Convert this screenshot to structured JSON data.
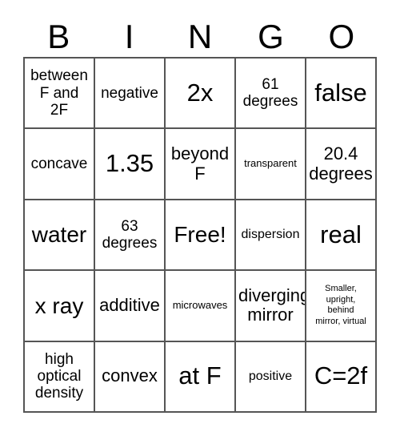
{
  "card": {
    "title": "BINGO",
    "headers": [
      "B",
      "I",
      "N",
      "G",
      "O"
    ],
    "grid": [
      [
        {
          "text": "between\nF and\n2F",
          "size": "md"
        },
        {
          "text": "negative",
          "size": "md"
        },
        {
          "text": "2x",
          "size": "xxl"
        },
        {
          "text": "61\ndegrees",
          "size": "md"
        },
        {
          "text": "false",
          "size": "xxl"
        }
      ],
      [
        {
          "text": "concave",
          "size": "md"
        },
        {
          "text": "1.35",
          "size": "xxl"
        },
        {
          "text": "beyond\nF",
          "size": "lg"
        },
        {
          "text": "transparent",
          "size": "xs"
        },
        {
          "text": "20.4\ndegrees",
          "size": "lg"
        }
      ],
      [
        {
          "text": "water",
          "size": "xl"
        },
        {
          "text": "63\ndegrees",
          "size": "md"
        },
        {
          "text": "Free!",
          "size": "xl"
        },
        {
          "text": "dispersion",
          "size": "sm"
        },
        {
          "text": "real",
          "size": "xxl"
        }
      ],
      [
        {
          "text": "x ray",
          "size": "xl"
        },
        {
          "text": "additive",
          "size": "lg"
        },
        {
          "text": "microwaves",
          "size": "xs"
        },
        {
          "text": "diverging\nmirror",
          "size": "lg"
        },
        {
          "text": "Smaller,\nupright,\nbehind\nmirror, virtual",
          "size": "xxs"
        }
      ],
      [
        {
          "text": "high\noptical\ndensity",
          "size": "md"
        },
        {
          "text": "convex",
          "size": "lg"
        },
        {
          "text": "at F",
          "size": "xxl"
        },
        {
          "text": "positive",
          "size": "sm"
        },
        {
          "text": "C=2f",
          "size": "xxl"
        }
      ]
    ],
    "colors": {
      "border": "#555555",
      "text": "#000000",
      "background": "#ffffff"
    }
  }
}
